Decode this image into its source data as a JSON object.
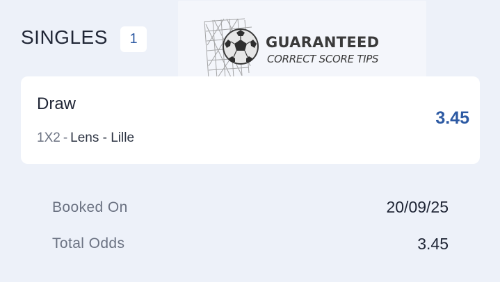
{
  "betslip": {
    "section_title": "SINGLES",
    "count": "1"
  },
  "banner": {
    "line1": "GUARANTEED",
    "line2": "CORRECT SCORE TIPS",
    "icon": "soccer-ball-icon"
  },
  "selection": {
    "name": "Draw",
    "market": "1X2",
    "separator": "-",
    "match": "Lens - Lille",
    "odds": "3.45"
  },
  "summary": {
    "booked_on_label": "Booked On",
    "booked_on_value": "20/09/25",
    "total_odds_label": "Total Odds",
    "total_odds_value": "3.45"
  },
  "colors": {
    "background": "#edf1f9",
    "card": "#ffffff",
    "accent": "#2d5aa3"
  }
}
